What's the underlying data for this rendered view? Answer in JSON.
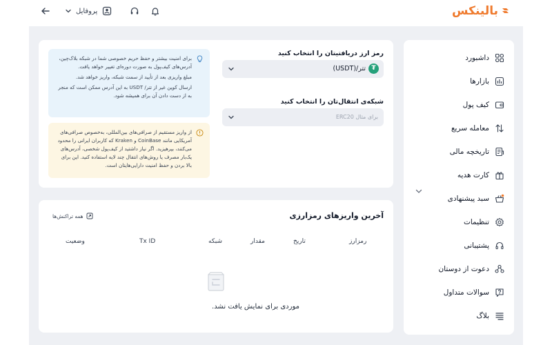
{
  "brand": {
    "name": "بالینکس",
    "color": "#ef7a2d"
  },
  "header": {
    "profile_label": "پروفایل",
    "icons": [
      "back-arrow-icon",
      "chevron-down-icon",
      "user-icon",
      "headset-icon",
      "bell-icon"
    ]
  },
  "sidebar": {
    "items": [
      {
        "label": "داشبورد",
        "icon": "dashboard-icon"
      },
      {
        "label": "بازارها",
        "icon": "markets-icon"
      },
      {
        "label": "کیف پول",
        "icon": "wallet-icon"
      },
      {
        "label": "معامله سریع",
        "icon": "swap-icon"
      },
      {
        "label": "تاریخچه مالی",
        "icon": "history-icon"
      },
      {
        "label": "کارت هدیه",
        "icon": "gift-icon"
      },
      {
        "label": "سبد پیشنهادی",
        "icon": "basket-icon"
      },
      {
        "label": "تنظیمات",
        "icon": "settings-icon"
      },
      {
        "label": "پشتیبانی",
        "icon": "support-icon"
      },
      {
        "label": "دعوت از دوستان",
        "icon": "invite-icon"
      },
      {
        "label": "سوالات متداول",
        "icon": "faq-icon"
      },
      {
        "label": "بلاگ",
        "icon": "blog-icon"
      }
    ]
  },
  "deposit": {
    "currency_label": "رمز ارز دریافتیتان را انتخاب کنید",
    "currency_value": "تتر/(USDT)",
    "network_label": "شبکه‌ی انتقال‌تان را انتخاب کنید",
    "network_placeholder": "برای مثال ERC20",
    "info_notes": [
      "برای امنیت بیشتر و حفظ حریم خصوصی شما در شبکه بلاک‌چین، آدرس‌های کیف‌پول به صورت دوره‌ای تغییر خواهد یافت.",
      "مبلغ واریزی بعد از تأیید از سمت شبکه، واریز خواهد شد.",
      "ارسال کوین غیر از تتر/ USDT به این آدرس ممکن است که منجر به از دست دادن آن برای همیشه شود."
    ],
    "warning_note": "از واریز مستقیم از صرافی‌های بین‌المللی، به‌خصوص صرافی‌های آمریکایی مانند CoinBase و Kraken که کاربران ایرانی را محدود می‌کنند، بپرهیزید. اگر نیاز داشتید از کیف‌پول شخصی، آدرس‌های یک‌بار مصرف یا روش‌های انتقال چند لایه استفاده کنید. این برای بالا بردن و حفظ امنیت دارایی‌هایتان است."
  },
  "transactions": {
    "title": "آخرین واریزهای رمزارزی",
    "all_link": "همه تراکنش‌ها",
    "columns": [
      "رمزارز",
      "تاریخ",
      "مقدار",
      "شبکه",
      "Tx ID",
      "وضعیت"
    ],
    "empty_text": "موردی برای نمایش یافت نشد."
  }
}
